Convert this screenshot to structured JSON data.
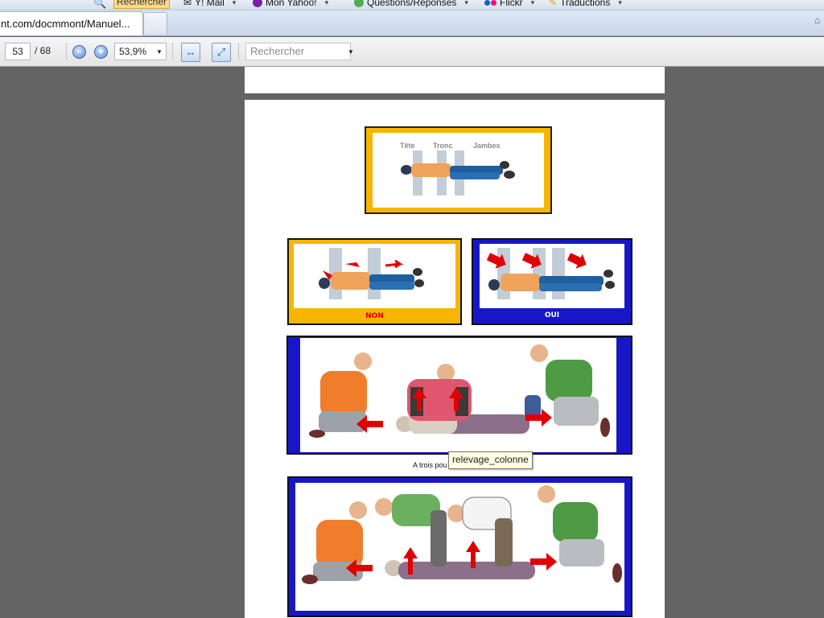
{
  "bookmarks": {
    "search_button": "Rechercher",
    "items": [
      {
        "label": "Y! Mail"
      },
      {
        "label": "Mon Yahoo!"
      },
      {
        "label": "Questions/Réponses"
      },
      {
        "label": "Flickr"
      },
      {
        "label": "Traductions"
      }
    ]
  },
  "tab": {
    "title": "nt.com/docmmont/Manuel..."
  },
  "viewer": {
    "current_page": "53",
    "page_total": "/ 68",
    "zoom": "53,9%",
    "search_placeholder": "Rechercher"
  },
  "document": {
    "axes_labels": [
      "Tête",
      "Tronc",
      "Jambes"
    ],
    "label_non": "NON",
    "label_oui": "OUI",
    "caption": "A trois pou"
  },
  "tooltip": "relevage_colonne",
  "colors": {
    "frame_yellow": "#f7b500",
    "frame_blue": "#1717c8",
    "arrow_red": "#e00000"
  }
}
